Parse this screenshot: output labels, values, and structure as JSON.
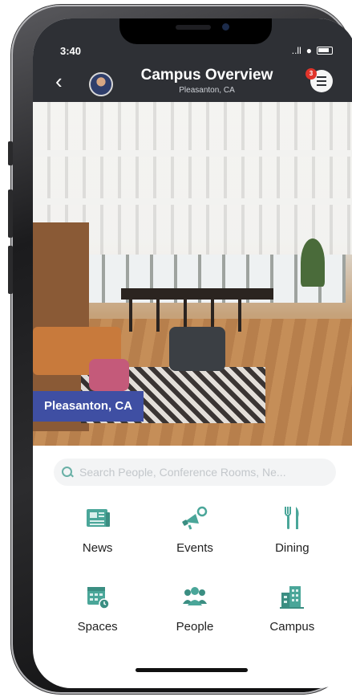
{
  "status_bar": {
    "time": "3:40",
    "signal": "..ll",
    "wifi": "●"
  },
  "header": {
    "back_label": "‹",
    "title": "Campus Overview",
    "subtitle": "Pleasanton, CA",
    "notification_count": "3"
  },
  "hero": {
    "location_label": "Pleasanton, CA"
  },
  "search": {
    "placeholder": "Search People, Conference Rooms, Ne...",
    "value": ""
  },
  "tiles": [
    {
      "label": "News",
      "icon": "news-icon"
    },
    {
      "label": "Events",
      "icon": "megaphone-icon"
    },
    {
      "label": "Dining",
      "icon": "fork-knife-icon"
    },
    {
      "label": "Spaces",
      "icon": "calendar-icon"
    },
    {
      "label": "People",
      "icon": "people-icon"
    },
    {
      "label": "Campus",
      "icon": "building-icon"
    }
  ],
  "colors": {
    "header_bg": "#2e3035",
    "accent": "#4aa699",
    "tag_bg": "#3f4fa3",
    "badge": "#e0342b"
  }
}
